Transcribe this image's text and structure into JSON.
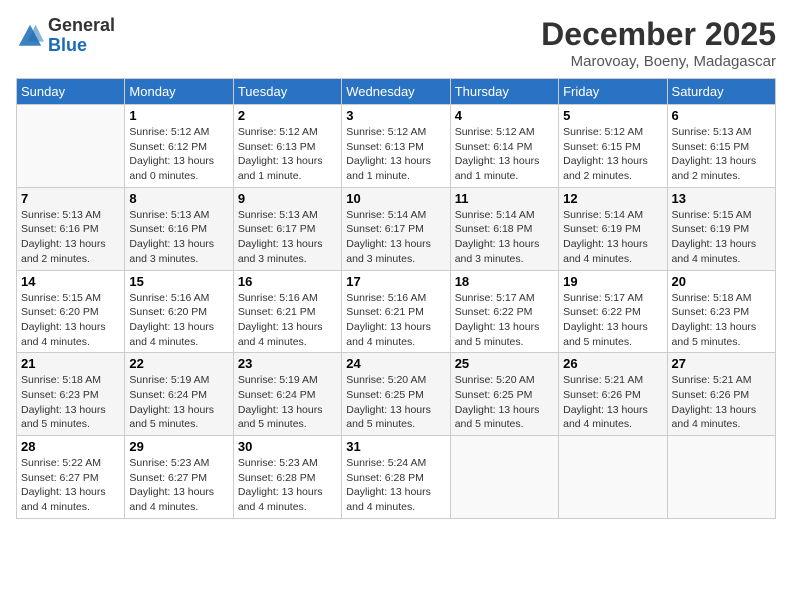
{
  "header": {
    "logo_general": "General",
    "logo_blue": "Blue",
    "month_title": "December 2025",
    "location": "Marovoay, Boeny, Madagascar"
  },
  "weekdays": [
    "Sunday",
    "Monday",
    "Tuesday",
    "Wednesday",
    "Thursday",
    "Friday",
    "Saturday"
  ],
  "weeks": [
    [
      {
        "day": "",
        "info": ""
      },
      {
        "day": "1",
        "info": "Sunrise: 5:12 AM\nSunset: 6:12 PM\nDaylight: 13 hours\nand 0 minutes."
      },
      {
        "day": "2",
        "info": "Sunrise: 5:12 AM\nSunset: 6:13 PM\nDaylight: 13 hours\nand 1 minute."
      },
      {
        "day": "3",
        "info": "Sunrise: 5:12 AM\nSunset: 6:13 PM\nDaylight: 13 hours\nand 1 minute."
      },
      {
        "day": "4",
        "info": "Sunrise: 5:12 AM\nSunset: 6:14 PM\nDaylight: 13 hours\nand 1 minute."
      },
      {
        "day": "5",
        "info": "Sunrise: 5:12 AM\nSunset: 6:15 PM\nDaylight: 13 hours\nand 2 minutes."
      },
      {
        "day": "6",
        "info": "Sunrise: 5:13 AM\nSunset: 6:15 PM\nDaylight: 13 hours\nand 2 minutes."
      }
    ],
    [
      {
        "day": "7",
        "info": "Sunrise: 5:13 AM\nSunset: 6:16 PM\nDaylight: 13 hours\nand 2 minutes."
      },
      {
        "day": "8",
        "info": "Sunrise: 5:13 AM\nSunset: 6:16 PM\nDaylight: 13 hours\nand 3 minutes."
      },
      {
        "day": "9",
        "info": "Sunrise: 5:13 AM\nSunset: 6:17 PM\nDaylight: 13 hours\nand 3 minutes."
      },
      {
        "day": "10",
        "info": "Sunrise: 5:14 AM\nSunset: 6:17 PM\nDaylight: 13 hours\nand 3 minutes."
      },
      {
        "day": "11",
        "info": "Sunrise: 5:14 AM\nSunset: 6:18 PM\nDaylight: 13 hours\nand 3 minutes."
      },
      {
        "day": "12",
        "info": "Sunrise: 5:14 AM\nSunset: 6:19 PM\nDaylight: 13 hours\nand 4 minutes."
      },
      {
        "day": "13",
        "info": "Sunrise: 5:15 AM\nSunset: 6:19 PM\nDaylight: 13 hours\nand 4 minutes."
      }
    ],
    [
      {
        "day": "14",
        "info": "Sunrise: 5:15 AM\nSunset: 6:20 PM\nDaylight: 13 hours\nand 4 minutes."
      },
      {
        "day": "15",
        "info": "Sunrise: 5:16 AM\nSunset: 6:20 PM\nDaylight: 13 hours\nand 4 minutes."
      },
      {
        "day": "16",
        "info": "Sunrise: 5:16 AM\nSunset: 6:21 PM\nDaylight: 13 hours\nand 4 minutes."
      },
      {
        "day": "17",
        "info": "Sunrise: 5:16 AM\nSunset: 6:21 PM\nDaylight: 13 hours\nand 4 minutes."
      },
      {
        "day": "18",
        "info": "Sunrise: 5:17 AM\nSunset: 6:22 PM\nDaylight: 13 hours\nand 5 minutes."
      },
      {
        "day": "19",
        "info": "Sunrise: 5:17 AM\nSunset: 6:22 PM\nDaylight: 13 hours\nand 5 minutes."
      },
      {
        "day": "20",
        "info": "Sunrise: 5:18 AM\nSunset: 6:23 PM\nDaylight: 13 hours\nand 5 minutes."
      }
    ],
    [
      {
        "day": "21",
        "info": "Sunrise: 5:18 AM\nSunset: 6:23 PM\nDaylight: 13 hours\nand 5 minutes."
      },
      {
        "day": "22",
        "info": "Sunrise: 5:19 AM\nSunset: 6:24 PM\nDaylight: 13 hours\nand 5 minutes."
      },
      {
        "day": "23",
        "info": "Sunrise: 5:19 AM\nSunset: 6:24 PM\nDaylight: 13 hours\nand 5 minutes."
      },
      {
        "day": "24",
        "info": "Sunrise: 5:20 AM\nSunset: 6:25 PM\nDaylight: 13 hours\nand 5 minutes."
      },
      {
        "day": "25",
        "info": "Sunrise: 5:20 AM\nSunset: 6:25 PM\nDaylight: 13 hours\nand 5 minutes."
      },
      {
        "day": "26",
        "info": "Sunrise: 5:21 AM\nSunset: 6:26 PM\nDaylight: 13 hours\nand 4 minutes."
      },
      {
        "day": "27",
        "info": "Sunrise: 5:21 AM\nSunset: 6:26 PM\nDaylight: 13 hours\nand 4 minutes."
      }
    ],
    [
      {
        "day": "28",
        "info": "Sunrise: 5:22 AM\nSunset: 6:27 PM\nDaylight: 13 hours\nand 4 minutes."
      },
      {
        "day": "29",
        "info": "Sunrise: 5:23 AM\nSunset: 6:27 PM\nDaylight: 13 hours\nand 4 minutes."
      },
      {
        "day": "30",
        "info": "Sunrise: 5:23 AM\nSunset: 6:28 PM\nDaylight: 13 hours\nand 4 minutes."
      },
      {
        "day": "31",
        "info": "Sunrise: 5:24 AM\nSunset: 6:28 PM\nDaylight: 13 hours\nand 4 minutes."
      },
      {
        "day": "",
        "info": ""
      },
      {
        "day": "",
        "info": ""
      },
      {
        "day": "",
        "info": ""
      }
    ]
  ]
}
